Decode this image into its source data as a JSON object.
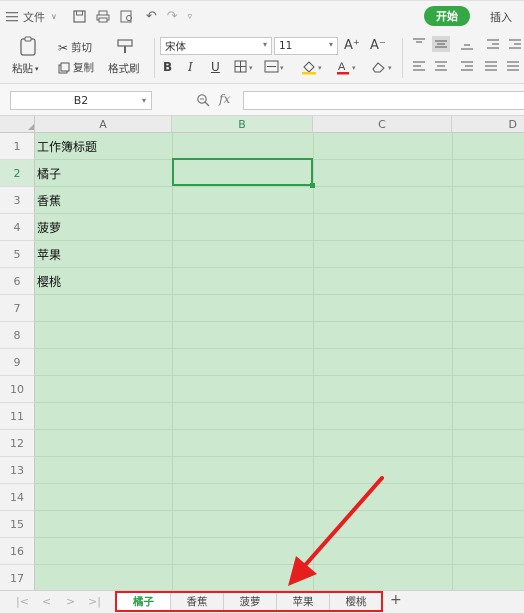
{
  "menubar": {
    "file_label": "文件",
    "tab_start": "开始",
    "tab_insert": "插入"
  },
  "ribbon": {
    "paste": "粘贴",
    "cut": "剪切",
    "copy": "复制",
    "format_painter": "格式刷",
    "font_name": "宋体",
    "font_size": "11",
    "bold": "B",
    "italic": "I",
    "underline": "U",
    "grow_font": "A⁺",
    "shrink_font": "A⁻"
  },
  "formula_bar": {
    "cell_ref": "B2",
    "fx": "fx",
    "content": ""
  },
  "grid": {
    "columns": [
      "A",
      "B",
      "C",
      "D"
    ],
    "selected_column": "B",
    "rows": [
      "1",
      "2",
      "3",
      "4",
      "5",
      "6",
      "7",
      "8",
      "9",
      "10",
      "11",
      "12",
      "13",
      "14",
      "15",
      "16",
      "17"
    ],
    "selected_row": "2",
    "cells_a": [
      "工作簿标题",
      "橘子",
      "香蕉",
      "菠萝",
      "苹果",
      "樱桃"
    ]
  },
  "sheet_tabs": {
    "tabs": [
      "橘子",
      "香蕉",
      "菠萝",
      "苹果",
      "樱桃"
    ],
    "active": "橘子",
    "add": "+"
  },
  "colors": {
    "accent_green": "#35a846",
    "grid_background": "#cce8cf",
    "annotation_red": "#e61e1e"
  }
}
